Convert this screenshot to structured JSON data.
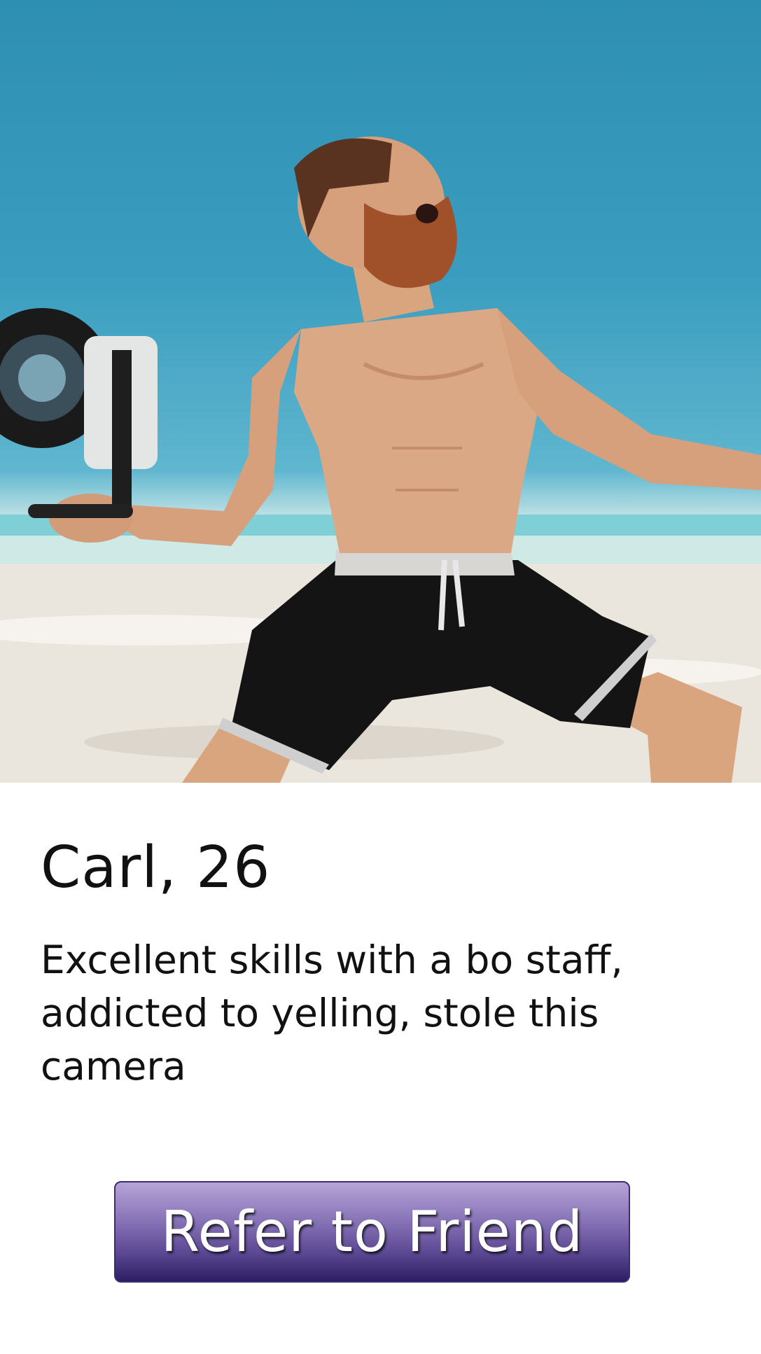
{
  "profile": {
    "name_age": "Carl, 26",
    "bio": "Excellent skills with a bo staff, addicted to yelling, stole this camera"
  },
  "actions": {
    "refer_label": "Refer to Friend"
  },
  "colors": {
    "sky": "#3a9dbf",
    "button_top": "#b6a4d6",
    "button_bottom": "#2d1d63"
  }
}
